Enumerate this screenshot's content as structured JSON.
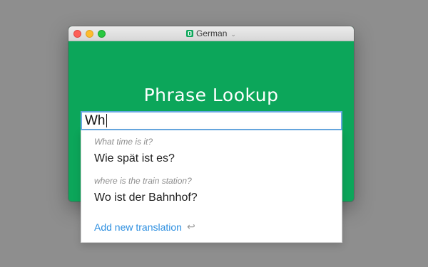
{
  "window": {
    "title": "German"
  },
  "app": {
    "heading": "Phrase Lookup"
  },
  "search": {
    "value": "Wh"
  },
  "suggestions": [
    {
      "source": "What time is it?",
      "target": "Wie spät ist es?"
    },
    {
      "source": "where is the train station?",
      "target": "Wo ist der Bahnhof?"
    }
  ],
  "actions": {
    "add_translation": "Add new translation"
  },
  "colors": {
    "brand_green": "#0ca65a",
    "link_blue": "#2d8fe0",
    "input_focus": "#67a9e3"
  },
  "icons": {
    "language": "book-icon",
    "dropdown": "chevron-down-icon",
    "return": "return-icon"
  }
}
